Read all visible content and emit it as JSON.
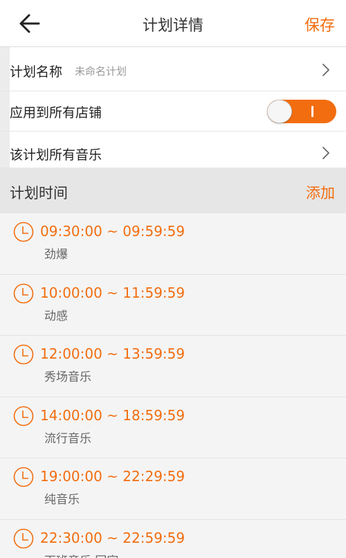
{
  "header": {
    "title": "计划详情",
    "save_label": "保存",
    "back_icon": "arrow-left-icon"
  },
  "plan": {
    "name_label": "计划名称",
    "name_value": "未命名计划",
    "apply_all_label": "应用到所有店铺",
    "apply_all_enabled": true,
    "all_music_label": "该计划所有音乐"
  },
  "schedule_section": {
    "title": "计划时间",
    "add_label": "添加"
  },
  "schedules": [
    {
      "time": "09:30:00 ~ 09:59:59",
      "music": "劲爆"
    },
    {
      "time": "10:00:00 ~ 11:59:59",
      "music": "动感"
    },
    {
      "time": "12:00:00 ~ 13:59:59",
      "music": "秀场音乐"
    },
    {
      "time": "14:00:00 ~ 18:59:59",
      "music": "流行音乐"
    },
    {
      "time": "19:00:00 ~ 22:29:59",
      "music": "纯音乐"
    },
    {
      "time": "22:30:00 ~ 22:59:59",
      "music": "下班音乐 回家"
    }
  ],
  "colors": {
    "accent": "#f26d0f",
    "section_bg": "#e6e6e6",
    "list_bg": "#f4f4f4"
  }
}
